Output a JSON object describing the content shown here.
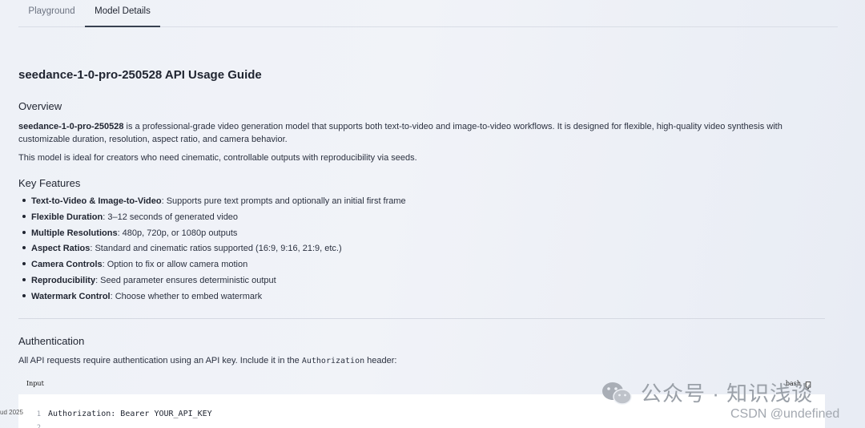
{
  "tabs": [
    "Playground",
    "Model Details"
  ],
  "title": "seedance-1-0-pro-250528 API Usage Guide",
  "overview": {
    "heading": "Overview",
    "p1_bold": "seedance-1-0-pro-250528",
    "p1_rest": " is a professional-grade video generation model that supports both text-to-video and image-to-video workflows. It is designed for flexible, high-quality video synthesis with customizable duration, resolution, aspect ratio, and camera behavior.",
    "p2": "This model is ideal for creators who need cinematic, controllable outputs with reproducibility via seeds."
  },
  "features": {
    "heading": "Key Features",
    "items": [
      {
        "label": "Text-to-Video & Image-to-Video",
        "text": ": Supports pure text prompts and optionally an initial first frame"
      },
      {
        "label": "Flexible Duration",
        "text": ": 3–12 seconds of generated video"
      },
      {
        "label": "Multiple Resolutions",
        "text": ": 480p, 720p, or 1080p outputs"
      },
      {
        "label": "Aspect Ratios",
        "text": ": Standard and cinematic ratios supported (16:9, 9:16, 21:9, etc.)"
      },
      {
        "label": "Camera Controls",
        "text": ": Option to fix or allow camera motion"
      },
      {
        "label": "Reproducibility",
        "text": ": Seed parameter ensures deterministic output"
      },
      {
        "label": "Watermark Control",
        "text": ": Choose whether to embed watermark"
      }
    ]
  },
  "auth": {
    "heading": "Authentication",
    "text_before": "All API requests require authentication using an API key. Include it in the ",
    "code": "Authorization",
    "text_after": " header:"
  },
  "code": {
    "label": "Input",
    "lang": "bash",
    "lines": [
      {
        "num": "1",
        "text": "Authorization: Bearer YOUR_API_KEY"
      },
      {
        "num": "2",
        "text": ""
      }
    ]
  },
  "side_note": "ud 2025",
  "watermark": {
    "text": "公众号 · 知识浅谈",
    "csdn": "CSDN @undefined"
  }
}
